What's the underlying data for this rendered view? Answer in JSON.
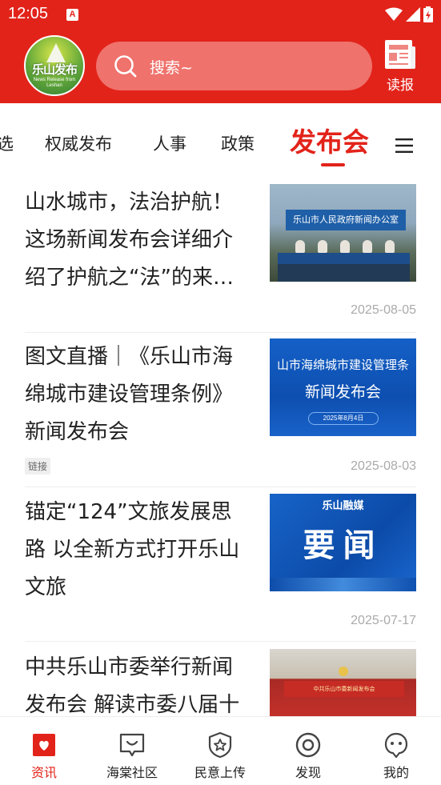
{
  "status_bar": {
    "time": "12:05",
    "notification_letter": "A"
  },
  "header": {
    "logo": {
      "title": "乐山发布",
      "subtitle_line1": "News Release from",
      "subtitle_line2": "Leshan"
    },
    "search_placeholder": "搜索~",
    "read_label": "读报"
  },
  "tabs": [
    {
      "label": "选"
    },
    {
      "label": "权威发布"
    },
    {
      "label": "人事"
    },
    {
      "label": "政策"
    },
    {
      "label": "发布会",
      "active": true
    }
  ],
  "feed": [
    {
      "title": "山水城市，法治护航！这场新闻发布会详细介绍了护航之“法”的来…",
      "date": "2025-08-05",
      "thumb_text": "乐山市人民政府新闻办公室"
    },
    {
      "title": "图文直播｜《乐山市海绵城市建设管理条例》新闻发布会",
      "date": "2025-08-03",
      "tag": "链接",
      "thumb_line1": "山市海绵城市建设管理条",
      "thumb_line2": "新闻发布会",
      "thumb_date": "2025年8月4日"
    },
    {
      "title": "锚定“124”文旅发展思路 以全新方式打开乐山文旅",
      "date": "2025-07-17",
      "thumb_top": "乐山融媒",
      "thumb_big": "要闻"
    },
    {
      "title": "中共乐山市委举行新闻发布会 解读市委八届十",
      "thumb_text": "中共乐山市委新闻发布会"
    }
  ],
  "bottom_nav": [
    {
      "label": "资讯",
      "icon": "news-icon",
      "active": true
    },
    {
      "label": "海棠社区",
      "icon": "community-icon"
    },
    {
      "label": "民意上传",
      "icon": "upload-opinion-icon"
    },
    {
      "label": "发现",
      "icon": "discover-icon"
    },
    {
      "label": "我的",
      "icon": "profile-icon"
    }
  ],
  "colors": {
    "brand_red": "#e2231a",
    "date_gray": "#aaaaaa"
  }
}
